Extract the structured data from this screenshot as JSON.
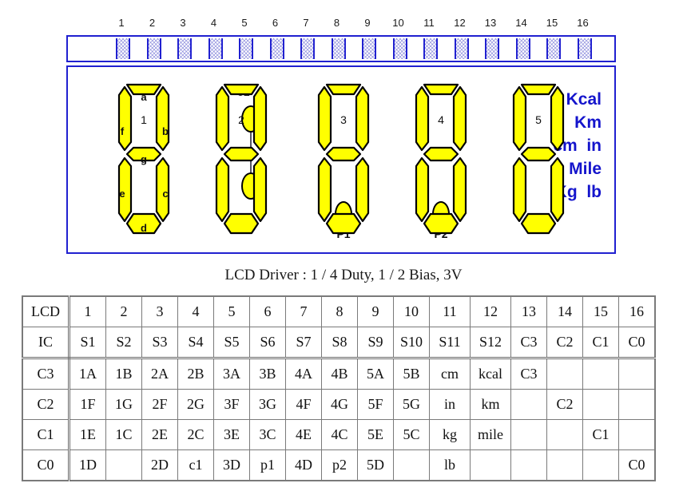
{
  "pin_header": {
    "numbers": [
      "1",
      "2",
      "3",
      "4",
      "5",
      "6",
      "7",
      "8",
      "9",
      "10",
      "11",
      "12",
      "13",
      "14",
      "15",
      "16"
    ]
  },
  "lcd_panel": {
    "digits": [
      {
        "number": "1",
        "segments": {
          "a": "a",
          "b": "b",
          "c": "c",
          "d": "d",
          "e": "e",
          "f": "f",
          "g": "g"
        }
      },
      {
        "number": "2",
        "segments": {
          "a": "",
          "b": "",
          "c": "",
          "d": "",
          "e": "",
          "f": "",
          "g": ""
        }
      },
      {
        "number": "3",
        "segments": {
          "a": "",
          "b": "",
          "c": "",
          "d": "",
          "e": "",
          "f": "",
          "g": ""
        }
      },
      {
        "number": "4",
        "segments": {
          "a": "",
          "b": "",
          "c": "",
          "d": "",
          "e": "",
          "f": "",
          "g": ""
        }
      },
      {
        "number": "5",
        "segments": {
          "a": "",
          "b": "",
          "c": "",
          "d": "",
          "e": "",
          "f": "",
          "g": ""
        }
      }
    ],
    "colon_label": "c1",
    "decimal_points": [
      {
        "label": "P1"
      },
      {
        "label": "P2"
      }
    ],
    "units": [
      "Kcal",
      "Km",
      "cm  in",
      "Mile",
      "Kg  lb"
    ],
    "colors": {
      "segment_fill": "#ffff00",
      "segment_stroke": "#000000",
      "panel_border": "#2020d0",
      "unit_text": "#1414cc"
    }
  },
  "caption": "LCD Driver : 1 / 4 Duty, 1 / 2 Bias, 3V",
  "pin_table": {
    "rows": [
      {
        "head": "LCD",
        "cells": [
          "1",
          "2",
          "3",
          "4",
          "5",
          "6",
          "7",
          "8",
          "9",
          "10",
          "11",
          "12",
          "13",
          "14",
          "15",
          "16"
        ]
      },
      {
        "head": "IC",
        "cells": [
          "S1",
          "S2",
          "S3",
          "S4",
          "S5",
          "S6",
          "S7",
          "S8",
          "S9",
          "S10",
          "S11",
          "S12",
          "C3",
          "C2",
          "C1",
          "C0"
        ]
      },
      {
        "head": "C3",
        "cells": [
          "1A",
          "1B",
          "2A",
          "2B",
          "3A",
          "3B",
          "4A",
          "4B",
          "5A",
          "5B",
          "cm",
          "kcal",
          "C3",
          "",
          "",
          ""
        ]
      },
      {
        "head": "C2",
        "cells": [
          "1F",
          "1G",
          "2F",
          "2G",
          "3F",
          "3G",
          "4F",
          "4G",
          "5F",
          "5G",
          "in",
          "km",
          "",
          "C2",
          "",
          ""
        ]
      },
      {
        "head": "C1",
        "cells": [
          "1E",
          "1C",
          "2E",
          "2C",
          "3E",
          "3C",
          "4E",
          "4C",
          "5E",
          "5C",
          "kg",
          "mile",
          "",
          "",
          "C1",
          ""
        ]
      },
      {
        "head": "C0",
        "cells": [
          "1D",
          "",
          "2D",
          "c1",
          "3D",
          "p1",
          "4D",
          "p2",
          "5D",
          "",
          "lb",
          "",
          "",
          "",
          "",
          "C0"
        ]
      }
    ]
  }
}
